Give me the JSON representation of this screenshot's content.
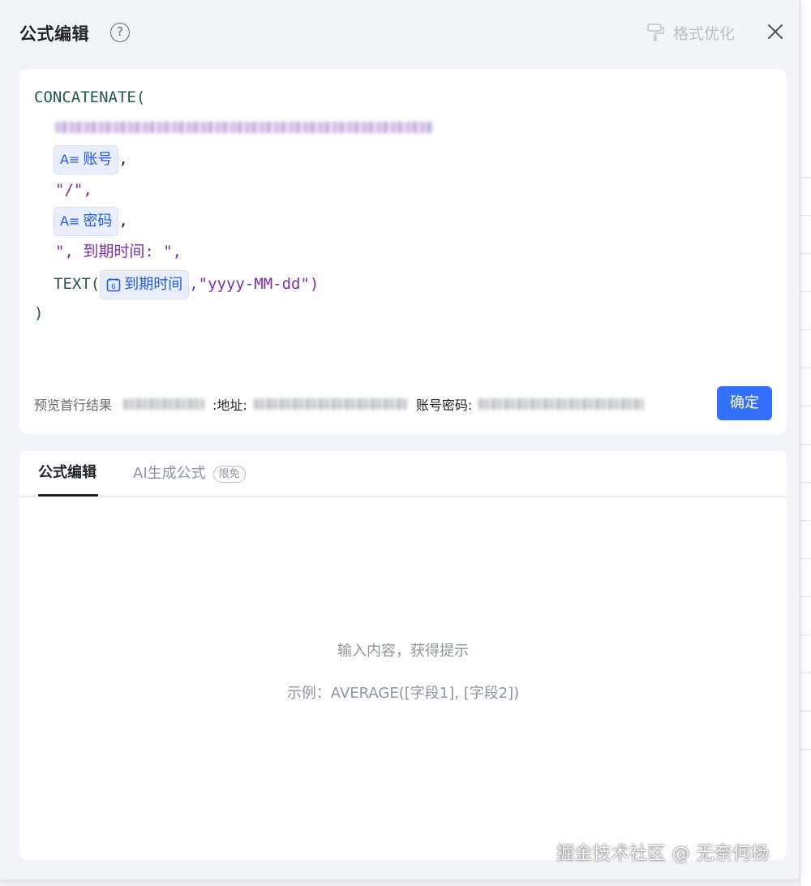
{
  "header": {
    "title": "公式编辑",
    "help_symbol": "?",
    "format_label": "格式优化"
  },
  "code": {
    "line1": "CONCATENATE(",
    "line3_chip": "账号",
    "line4": "\"/\",",
    "line5_chip": "密码",
    "line6": "\", 到期时间: \",",
    "line7_fn": "TEXT(",
    "line7_chip": "到期时间",
    "line7_arg": ",\"yyyy-MM-dd\")",
    "line8": ")",
    "comma": ","
  },
  "preview": {
    "label": "预览首行结果",
    "addr_label": ":地址:",
    "account_label": "账号密码:"
  },
  "confirm_label": "确定",
  "tabs": {
    "active": "公式编辑",
    "ai": "AI生成公式",
    "ai_badge": "限免"
  },
  "hint": {
    "line1": "输入内容，获得提示",
    "line2": "示例：AVERAGE([字段1], [字段2])"
  },
  "watermark": "掘金技术社区 @ 无奈何杨",
  "colors": {
    "accent": "#3370ff",
    "function": "#24584c",
    "string": "#7b2ea8"
  }
}
